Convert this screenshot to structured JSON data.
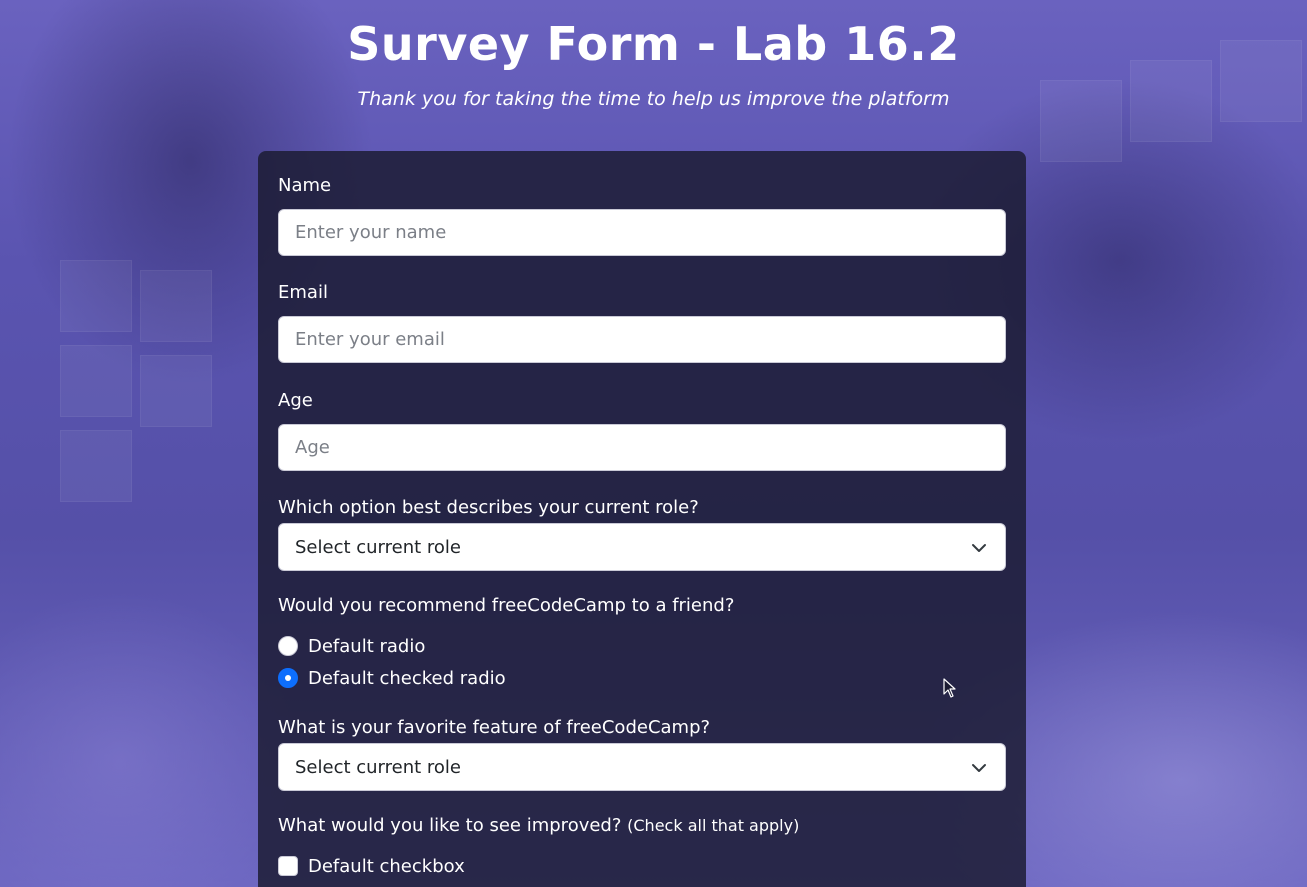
{
  "header": {
    "title": "Survey Form - Lab 16.2",
    "description": "Thank you for taking the time to help us improve the platform"
  },
  "form": {
    "name": {
      "label": "Name",
      "placeholder": "Enter your name",
      "value": ""
    },
    "email": {
      "label": "Email",
      "placeholder": "Enter your email",
      "value": ""
    },
    "age": {
      "label": "Age",
      "placeholder": "Age",
      "value": ""
    },
    "role": {
      "label": "Which option best describes your current role?",
      "selected": "Select current role",
      "icon": "chevron-down-icon"
    },
    "recommend": {
      "label": "Would you recommend freeCodeCamp to a friend?",
      "options": [
        {
          "label": "Default radio",
          "checked": false
        },
        {
          "label": "Default checked radio",
          "checked": true
        }
      ]
    },
    "feature": {
      "label": "What is your favorite feature of freeCodeCamp?",
      "selected": "Select current role",
      "icon": "chevron-down-icon"
    },
    "improve": {
      "label": "What would you like to see improved?",
      "hint": "(Check all that apply)",
      "options": [
        {
          "label": "Default checkbox",
          "checked": false
        }
      ]
    }
  },
  "colors": {
    "card_background": "#1b1b32",
    "accent": "#0d6efd",
    "page_tint": "#5a54b0"
  }
}
